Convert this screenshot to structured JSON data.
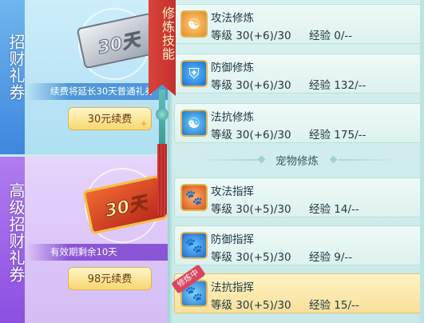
{
  "left_cards": [
    {
      "title": "招财礼券",
      "ticket_text": "30天",
      "note": "续费将延长30天普通礼券",
      "button_label": "30元续费"
    },
    {
      "title": "高级招财礼券",
      "ticket_text": "30天",
      "note": "有效期剩余10天",
      "button_label": "98元续费"
    }
  ],
  "ribbon_label": "修炼技能",
  "exp_label": "经验",
  "level_label": "等级",
  "skills": [
    {
      "name": "攻法修炼",
      "level": "30(+6)/30",
      "exp": "0/--",
      "icon": "attack-magic-icon"
    },
    {
      "name": "防御修炼",
      "level": "30(+6)/30",
      "exp": "132/--",
      "icon": "defense-icon"
    },
    {
      "name": "法抗修炼",
      "level": "30(+6)/30",
      "exp": "175/--",
      "icon": "magic-resist-icon"
    }
  ],
  "pet_section_title": "宠物修炼",
  "pet_skills": [
    {
      "name": "攻法指挥",
      "level": "30(+5)/30",
      "exp": "14/--",
      "icon": "pet-attack-icon"
    },
    {
      "name": "防御指挥",
      "level": "30(+5)/30",
      "exp": "9/--",
      "icon": "pet-defense-icon"
    },
    {
      "name": "法抗指挥",
      "level": "30(+5)/30",
      "exp": "15/--",
      "icon": "pet-resist-icon",
      "badge": "修炼中"
    }
  ],
  "colors": {
    "panel": "#d7f1ef",
    "active_row": "#f8e09a",
    "ribbon": "#d9433b"
  }
}
